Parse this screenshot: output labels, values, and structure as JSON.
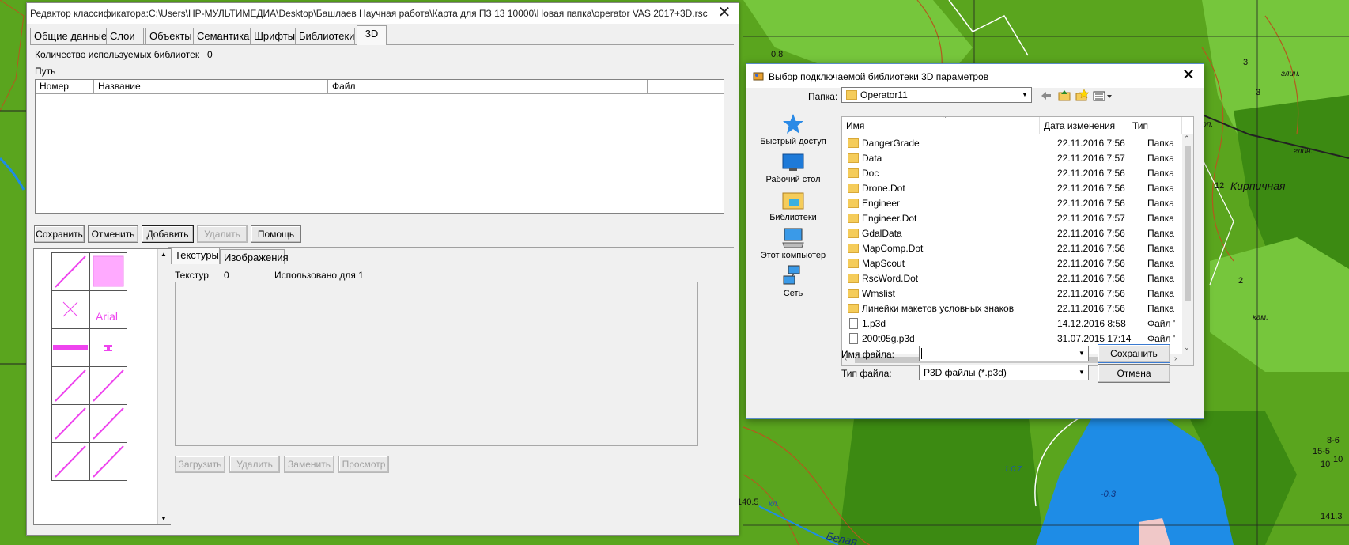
{
  "map": {
    "labels": [
      "0.8",
      "3",
      "глин.",
      "3",
      "кирп.",
      "глин.",
      "12",
      "Кирпичная",
      "2",
      "кам.",
      "1.0.7",
      "-0.3",
      "15-5",
      "10",
      "8-6",
      "10",
      "140.5",
      "кл.",
      "141.3",
      "Белая"
    ],
    "colors": {
      "green": "#5aa51e",
      "light_green": "#76c63c",
      "dark_green": "#3c8a12",
      "lake": "#1e8ce6",
      "contour": "#b35a1e"
    }
  },
  "main": {
    "title": "Редактор классификатора:C:\\Users\\HP-МУЛЬТИМЕДИА\\Desktop\\Башлаев Научная работа\\Карта для ПЗ 13 10000\\Новая папка\\operator VAS 2017+3D.rsc",
    "close": "✕",
    "tabs": [
      "Общие данные",
      "Слои",
      "Объекты",
      "Семантика",
      "Шрифты",
      "Библиотеки",
      "3D"
    ],
    "lib_count_label": "Количество используемых библиотек",
    "lib_count_value": "0",
    "path_label": "Путь",
    "columns": [
      "Номер",
      "Название",
      "Файл"
    ],
    "buttons": {
      "save": "Сохранить",
      "cancel": "Отменить",
      "add": "Добавить",
      "delete": "Удалить",
      "help": "Помощь"
    },
    "cells": {
      "arial_label": "Arial"
    },
    "texture_tabs": [
      "Текстуры",
      "Изображения"
    ],
    "texture_count_label": "Текстур",
    "texture_count_value": "0",
    "used_for_label": "Использовано для 1",
    "texture_buttons": {
      "load": "Загрузить",
      "delete": "Удалить",
      "replace": "Заменить",
      "view": "Просмотр"
    },
    "scroll_up": "▲",
    "scroll_down": "▼"
  },
  "dialog": {
    "title": "Выбор подключаемой библиотеки 3D параметров",
    "close": "✕",
    "folder_label": "Папка:",
    "folder_value": "Operator11",
    "places": [
      "Быстрый доступ",
      "Рабочий стол",
      "Библиотеки",
      "Этот компьютер",
      "Сеть"
    ],
    "columns": {
      "name": "Имя",
      "date": "Дата изменения",
      "type": "Тип"
    },
    "files": [
      {
        "name": "DangerGrade",
        "date": "22.11.2016 7:56",
        "type": "Папка",
        "kind": "folder"
      },
      {
        "name": "Data",
        "date": "22.11.2016 7:57",
        "type": "Папка",
        "kind": "folder"
      },
      {
        "name": "Doc",
        "date": "22.11.2016 7:56",
        "type": "Папка",
        "kind": "folder"
      },
      {
        "name": "Drone.Dot",
        "date": "22.11.2016 7:56",
        "type": "Папка",
        "kind": "folder"
      },
      {
        "name": "Engineer",
        "date": "22.11.2016 7:56",
        "type": "Папка",
        "kind": "folder"
      },
      {
        "name": "Engineer.Dot",
        "date": "22.11.2016 7:57",
        "type": "Папка",
        "kind": "folder"
      },
      {
        "name": "GdalData",
        "date": "22.11.2016 7:56",
        "type": "Папка",
        "kind": "folder"
      },
      {
        "name": "MapComp.Dot",
        "date": "22.11.2016 7:56",
        "type": "Папка",
        "kind": "folder"
      },
      {
        "name": "MapScout",
        "date": "22.11.2016 7:56",
        "type": "Папка",
        "kind": "folder"
      },
      {
        "name": "RscWord.Dot",
        "date": "22.11.2016 7:56",
        "type": "Папка",
        "kind": "folder"
      },
      {
        "name": "Wmslist",
        "date": "22.11.2016 7:56",
        "type": "Папка",
        "kind": "folder"
      },
      {
        "name": "Линейки макетов условных знаков",
        "date": "22.11.2016 7:56",
        "type": "Папка",
        "kind": "folder"
      },
      {
        "name": "1.p3d",
        "date": "14.12.2016 8:58",
        "type": "Файл '",
        "kind": "file"
      },
      {
        "name": "200t05g.p3d",
        "date": "31.07.2015 17:14",
        "type": "Файл '",
        "kind": "file"
      }
    ],
    "filename_label": "Имя файла:",
    "filename_value": "",
    "filetype_label": "Тип файла:",
    "filetype_value": "P3D файлы (*.p3d)",
    "save_button": "Сохранить",
    "cancel_button": "Отмена"
  }
}
